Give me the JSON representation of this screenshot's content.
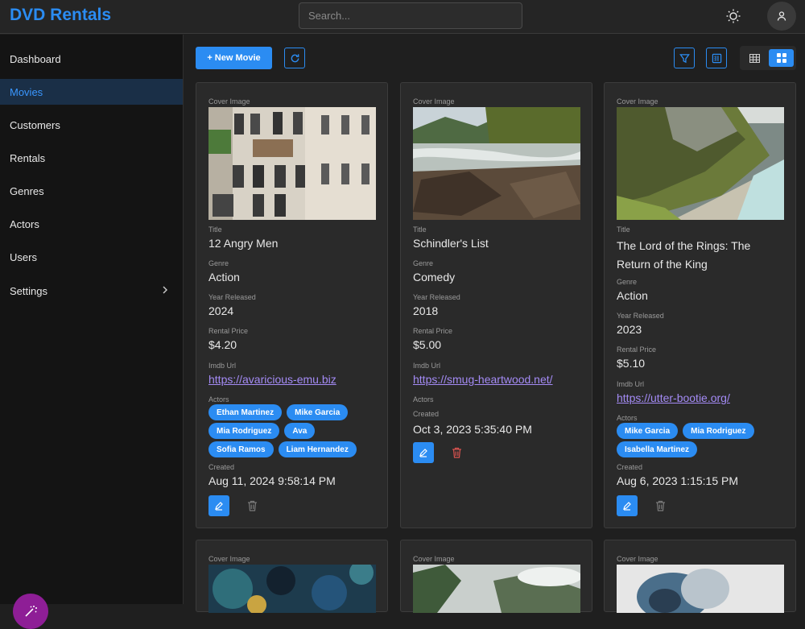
{
  "app": {
    "title": "DVD Rentals"
  },
  "search": {
    "placeholder": "Search..."
  },
  "sidebar": {
    "items": [
      {
        "label": "Dashboard",
        "active": false
      },
      {
        "label": "Movies",
        "active": true
      },
      {
        "label": "Customers",
        "active": false
      },
      {
        "label": "Rentals",
        "active": false
      },
      {
        "label": "Genres",
        "active": false
      },
      {
        "label": "Actors",
        "active": false
      },
      {
        "label": "Users",
        "active": false
      },
      {
        "label": "Settings",
        "active": false,
        "has_submenu": true
      }
    ]
  },
  "toolbar": {
    "new_label": "+ New Movie",
    "refresh_icon": "refresh-icon",
    "filter_icon": "filter-icon",
    "columns_icon": "columns-icon",
    "view_modes": [
      "table",
      "grid"
    ],
    "active_view": "grid"
  },
  "labels": {
    "cover": "Cover Image",
    "title": "Title",
    "genre": "Genre",
    "year": "Year Released",
    "price": "Rental Price",
    "imdb": "Imdb Url",
    "actors": "Actors",
    "created": "Created"
  },
  "movies": [
    {
      "title": "12 Angry Men",
      "genre": "Action",
      "year": "2024",
      "price": "$4.20",
      "imdb": "https://avaricious-emu.biz",
      "actors": [
        "Ethan Martinez",
        "Mike Garcia",
        "Mia Rodriguez",
        "Ava",
        "Sofia Ramos",
        "Liam Hernandez"
      ],
      "created": "Aug 11, 2024 9:58:14 PM"
    },
    {
      "title": "Schindler's List",
      "genre": "Comedy",
      "year": "2018",
      "price": "$5.00",
      "imdb": "https://smug-heartwood.net/",
      "actors": [],
      "created": "Oct 3, 2023 5:35:40 PM"
    },
    {
      "title": "The Lord of the Rings: The Return of the King",
      "genre": "Action",
      "year": "2023",
      "price": "$5.10",
      "imdb": "https://utter-bootie.org/",
      "actors": [
        "Mike Garcia",
        "Mia Rodriguez",
        "Isabella Martinez"
      ],
      "created": "Aug 6, 2023 1:15:15 PM"
    },
    {
      "title": "",
      "genre": ""
    },
    {
      "title": "",
      "genre": ""
    },
    {
      "title": "",
      "genre": ""
    }
  ],
  "colors": {
    "accent": "#2b8cf2",
    "active_nav_bg": "#1a2f47",
    "link": "#a48bf5",
    "fab": "#8e1e96",
    "delete": "#d9534f"
  }
}
